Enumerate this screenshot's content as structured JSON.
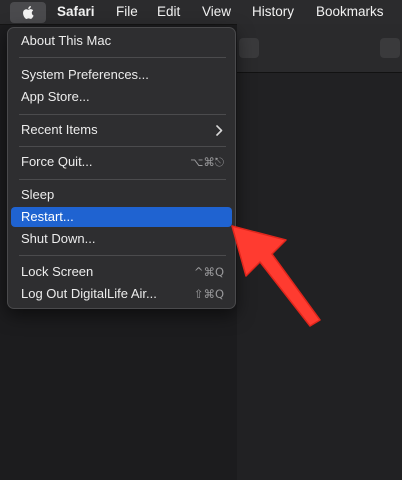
{
  "menubar": {
    "app": "Safari",
    "items": [
      "File",
      "Edit",
      "View",
      "History",
      "Bookmarks"
    ]
  },
  "apple_menu": {
    "about": "About This Mac",
    "system_preferences": "System Preferences...",
    "app_store": "App Store...",
    "recent_items": "Recent Items",
    "force_quit": "Force Quit...",
    "force_quit_shortcut": "⌥⌘⎋",
    "sleep": "Sleep",
    "restart": "Restart...",
    "shut_down": "Shut Down...",
    "lock_screen": "Lock Screen",
    "lock_screen_shortcut": "^⌘Q",
    "log_out": "Log Out DigitalLife Air...",
    "log_out_shortcut": "⇧⌘Q",
    "selected": "Restart..."
  },
  "colors": {
    "highlight": "#1f63d1",
    "annotation_arrow": "#ff3b30"
  },
  "icons": [
    "apple-logo-icon",
    "chevron-right-icon",
    "annotation-arrow-icon"
  ]
}
